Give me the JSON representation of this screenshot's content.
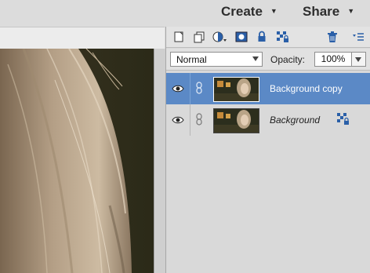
{
  "topbar": {
    "create_label": "Create",
    "share_label": "Share"
  },
  "layers_panel": {
    "toolbar_icons": [
      "new-layer-icon",
      "new-group-icon",
      "adjustment-layer-icon",
      "layer-mask-icon",
      "lock-all-icon",
      "lock-transparency-icon",
      "delete-layer-icon",
      "panel-menu-icon"
    ],
    "blend_mode": "Normal",
    "opacity_label": "Opacity:",
    "opacity_value": "100%",
    "layers": [
      {
        "name": "Background copy",
        "selected": true,
        "italic": false,
        "locked": false,
        "visible": true
      },
      {
        "name": "Background",
        "selected": false,
        "italic": true,
        "locked": true,
        "visible": true
      }
    ]
  },
  "colors": {
    "selection": "#5b89c6",
    "panel_bg": "#d9d9d9"
  }
}
